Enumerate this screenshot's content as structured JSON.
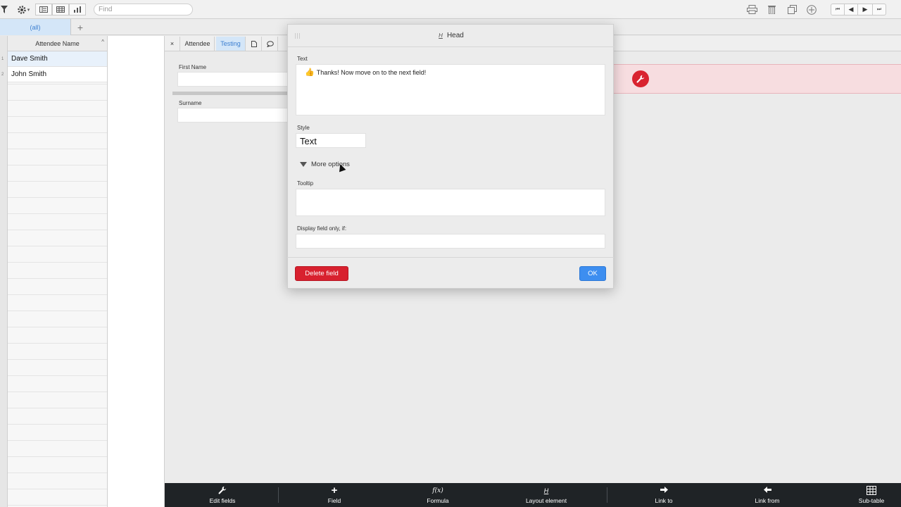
{
  "toolbar": {
    "find_placeholder": "Find",
    "icons": [
      "filter-icon",
      "gear-icon",
      "form-view-icon",
      "grid-view-icon",
      "chart-view-icon",
      "print-icon",
      "trash-icon",
      "duplicate-icon",
      "add-record-icon",
      "first-record-icon",
      "prev-record-icon",
      "next-record-icon",
      "last-record-icon"
    ]
  },
  "tabs": {
    "all_label": "(all)",
    "add_label": "+"
  },
  "list": {
    "header": "Attendee Name",
    "rows": [
      {
        "num": "1",
        "name": "Dave Smith"
      },
      {
        "num": "2",
        "name": "John Smith"
      }
    ]
  },
  "form_tabs": {
    "close": "×",
    "attendee": "Attendee",
    "testing": "Testing"
  },
  "form": {
    "first_name_label": "First Name",
    "surname_label": "Surname"
  },
  "dialog": {
    "title": "Head",
    "title_icon": "H",
    "text_label": "Text",
    "text_value": "Thanks! Now move on to the next field!",
    "style_label": "Style",
    "style_value": "Text",
    "more_options": "More options",
    "tooltip_label": "Tooltip",
    "tooltip_value": "",
    "display_if_label": "Display field only, if:",
    "display_if_value": "",
    "delete_button": "Delete field",
    "ok_button": "OK"
  },
  "bottom_bar": {
    "items": [
      {
        "label": "Edit fields",
        "icon": "wrench-icon"
      },
      {
        "label": "Field",
        "icon": "plus-icon"
      },
      {
        "label": "Formula",
        "icon": "fx-icon",
        "glyph": "f(x)"
      },
      {
        "label": "Layout element",
        "icon": "layout-element-icon",
        "glyph": "H"
      },
      {
        "label": "Link to",
        "icon": "arrow-right-icon"
      },
      {
        "label": "Link from",
        "icon": "arrow-left-icon"
      },
      {
        "label": "Sub-table",
        "icon": "grid-icon"
      }
    ]
  },
  "colors": {
    "accent_blue": "#3d8ef0",
    "danger_red": "#d8212f",
    "tab_active_bg": "#d4e6f8",
    "bottom_bar_bg": "#1f2326"
  }
}
